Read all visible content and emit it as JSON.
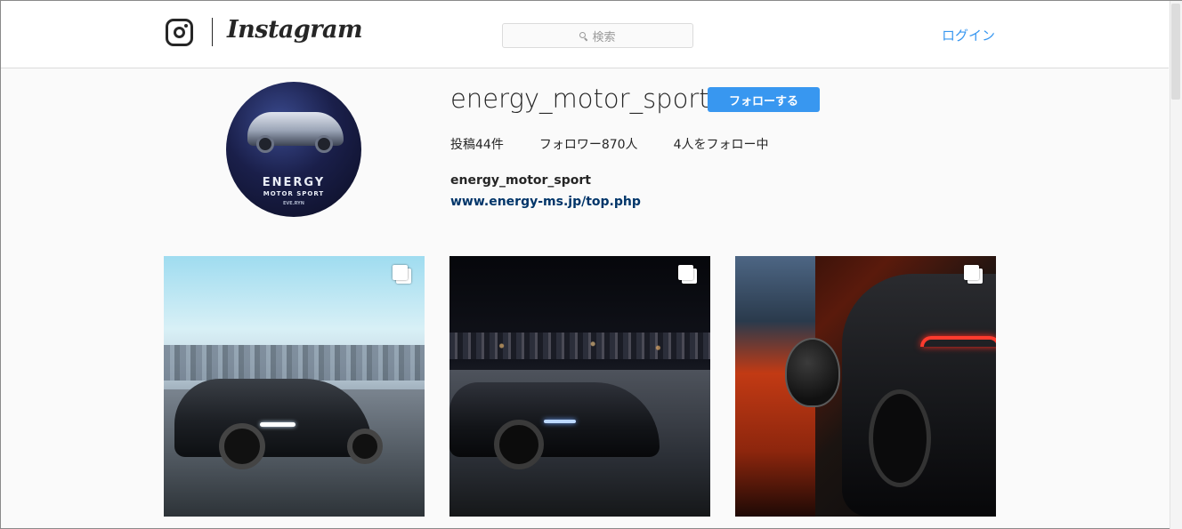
{
  "brand": {
    "wordmark": "Instagram"
  },
  "header": {
    "search_placeholder": "検索",
    "login_label": "ログイン"
  },
  "profile": {
    "username": "energy_motor_sport",
    "follow_label": "フォローする",
    "stats": [
      {
        "label": "投稿44件"
      },
      {
        "label": "フォロワー870人"
      },
      {
        "label": "4人をフォロー中"
      }
    ],
    "full_name": "energy_motor_sport",
    "website": "www.energy-ms.jp/top.php",
    "avatar_text": {
      "line1": "ENERGY",
      "line2": "MOTOR SPORT",
      "line3": "EVE.RYN"
    }
  },
  "posts": [
    {
      "icon": "multi-photo-icon"
    },
    {
      "icon": "multi-photo-icon"
    },
    {
      "icon": "multi-photo-icon"
    }
  ],
  "colors": {
    "accent": "#3897f0",
    "link": "#003569",
    "text": "#262626",
    "background": "#fafafa"
  }
}
